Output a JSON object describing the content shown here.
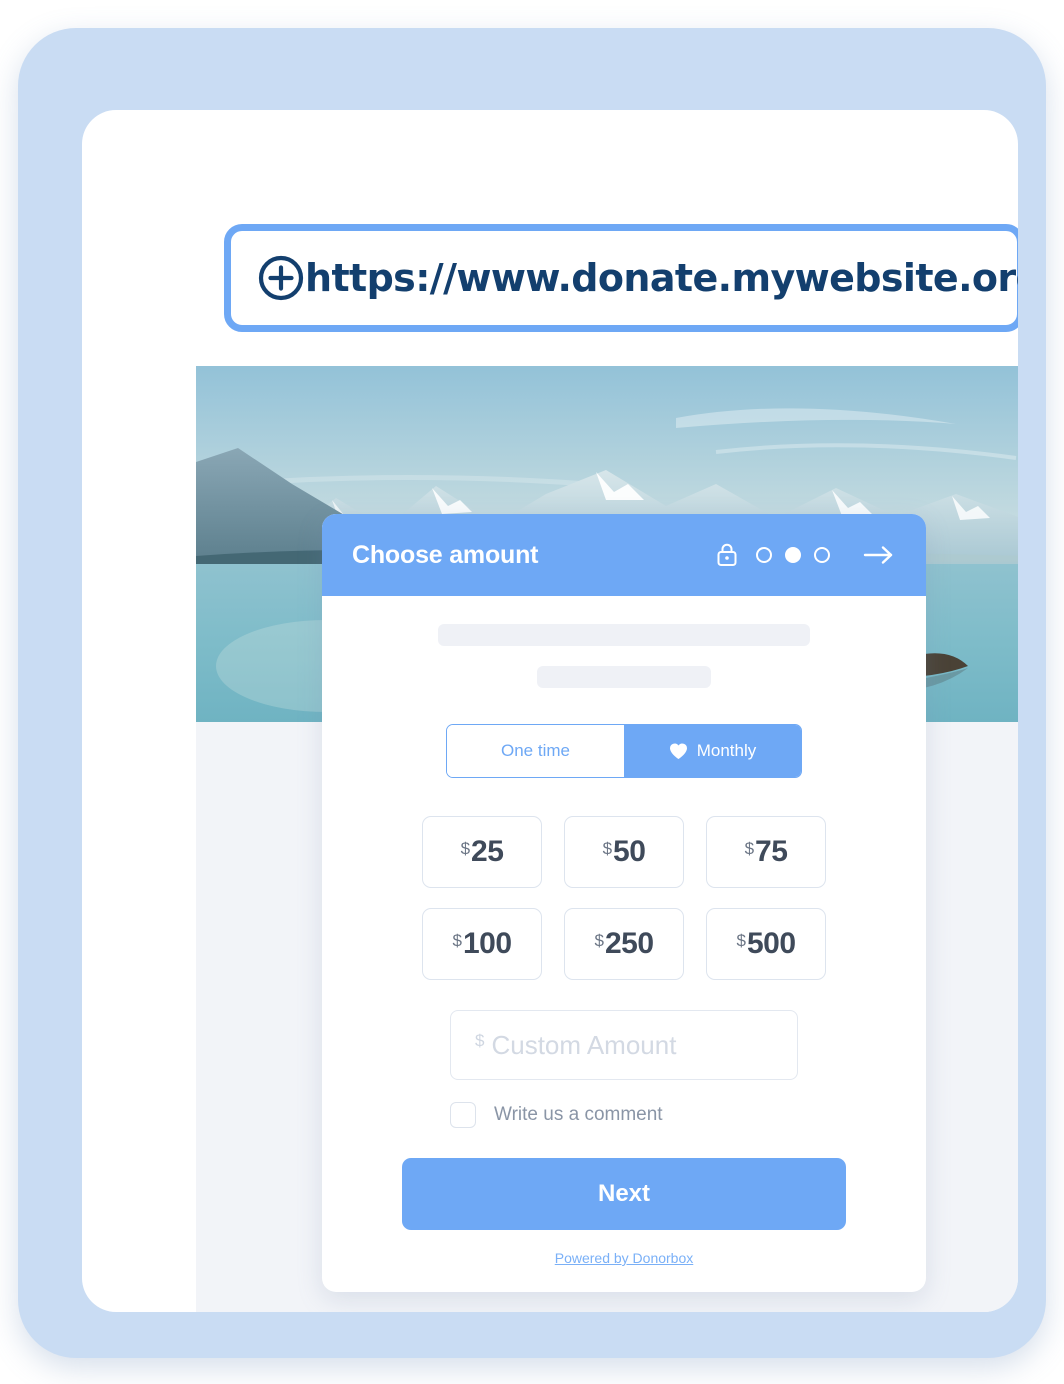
{
  "browser": {
    "url": "https://www.donate.mywebsite.org",
    "new_tab_icon": "plus-circle-icon",
    "reload_icon": "reload-icon"
  },
  "hero": {
    "alt": "mountain lake landscape"
  },
  "form": {
    "header": {
      "title": "Choose amount",
      "lock_icon": "lock-icon",
      "arrow_icon": "arrow-right-icon",
      "steps": [
        {
          "filled": false
        },
        {
          "filled": true
        },
        {
          "filled": false
        }
      ],
      "current_step": 2,
      "total_steps": 3
    },
    "recurrence": {
      "options": [
        {
          "label": "One time",
          "active": false,
          "icon": null
        },
        {
          "label": "Monthly",
          "active": true,
          "icon": "heart-icon"
        }
      ]
    },
    "currency_symbol": "$",
    "amounts": [
      {
        "value": "25"
      },
      {
        "value": "50"
      },
      {
        "value": "75"
      },
      {
        "value": "100"
      },
      {
        "value": "250"
      },
      {
        "value": "500"
      }
    ],
    "custom_amount": {
      "currency_symbol": "$",
      "placeholder": "Custom Amount",
      "value": ""
    },
    "comment": {
      "label": "Write us a comment",
      "checked": false
    },
    "next_label": "Next",
    "powered_by": "Powered by Donorbox"
  },
  "colors": {
    "accent_blue": "#6ea8f5",
    "frame_blue": "#c9dcf3",
    "url_text": "#133f6e",
    "page_bg": "#f2f4f8",
    "amount_text": "#3f4a5a",
    "placeholder": "#d3d9e3"
  }
}
